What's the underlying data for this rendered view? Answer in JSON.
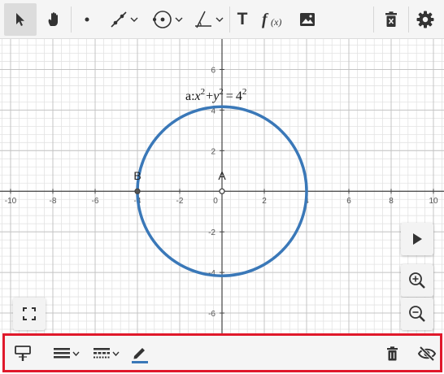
{
  "toolbar": {
    "tools": [
      {
        "name": "select",
        "icon": "pointer-icon",
        "active": true
      },
      {
        "name": "pan",
        "icon": "hand-icon"
      },
      {
        "name": "point",
        "icon": "point-icon"
      },
      {
        "name": "line",
        "icon": "line-icon",
        "dropdown": true
      },
      {
        "name": "circle",
        "icon": "circle-icon",
        "dropdown": true
      },
      {
        "name": "angle",
        "icon": "angle-icon",
        "dropdown": true
      },
      {
        "name": "text",
        "icon": "text-icon",
        "label": "T"
      },
      {
        "name": "function",
        "icon": "function-icon"
      },
      {
        "name": "image",
        "icon": "image-icon"
      },
      {
        "name": "clear",
        "icon": "trash-x-icon"
      },
      {
        "name": "settings",
        "icon": "gear-icon"
      }
    ]
  },
  "graph": {
    "x_range": [
      -10.5,
      10.5
    ],
    "y_range": [
      -7,
      7.5
    ],
    "x_ticks": [
      "-10",
      "-8",
      "-6",
      "-4",
      "-2",
      "0",
      "2",
      "4",
      "6",
      "8",
      "10"
    ],
    "y_ticks": [
      "6",
      "4",
      "2",
      "-2",
      "-4",
      "-6"
    ],
    "circle": {
      "name": "a",
      "center": [
        0,
        0
      ],
      "radius": 4,
      "color": "#3a78b8"
    },
    "points": [
      {
        "label": "A",
        "x": 0,
        "y": 0
      },
      {
        "label": "B",
        "x": -4,
        "y": 0
      }
    ]
  },
  "equation": {
    "prefix": "a:",
    "x": "x",
    "y": "y",
    "exp": "2",
    "plus": "+",
    "equals": "=",
    "rhs": "4"
  },
  "controls": {
    "play": "play-icon",
    "zoom_in": "zoom-in-icon",
    "zoom_out": "zoom-out-icon",
    "fullscreen": "fullscreen-icon"
  },
  "style_bar": {
    "border_color": "#e0192b",
    "items": [
      {
        "name": "point-style",
        "icon": "point-style-icon"
      },
      {
        "name": "line-thickness",
        "icon": "line-thickness-icon",
        "dropdown": true
      },
      {
        "name": "line-style",
        "icon": "line-style-icon",
        "dropdown": true
      },
      {
        "name": "color",
        "icon": "pen-icon",
        "color": "#3a78b8"
      },
      {
        "name": "delete",
        "icon": "trash-icon"
      },
      {
        "name": "visibility",
        "icon": "eye-off-icon"
      }
    ]
  }
}
